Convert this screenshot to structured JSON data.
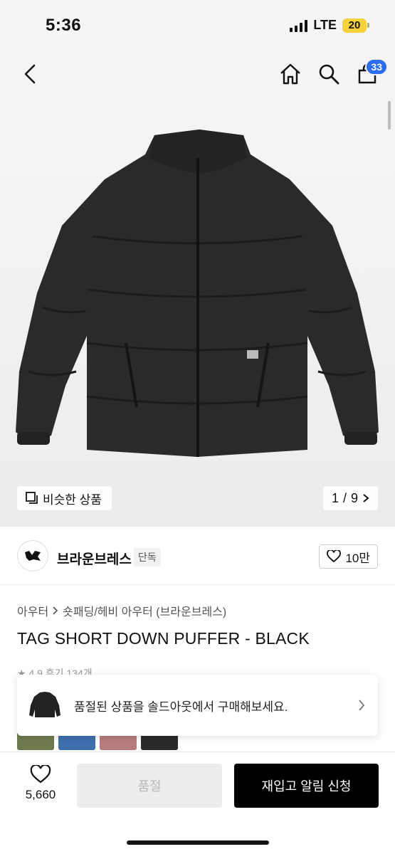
{
  "status": {
    "time": "5:36",
    "network": "LTE",
    "battery": "20"
  },
  "header": {
    "cart_count": "33"
  },
  "gallery": {
    "similar_label": "비슷한 상품",
    "page_current": "1",
    "page_separator": "/",
    "page_total": "9"
  },
  "brand": {
    "name": "브라운브레스",
    "tag": "단독",
    "likes": "10만"
  },
  "product": {
    "category_1": "아우터",
    "category_2": "숏패딩/헤비 아우터 (브라운브레스)",
    "title": "TAG SHORT DOWN PUFFER - BLACK",
    "rating_peek": "★ 4.9  후기 134개"
  },
  "banner": {
    "text": "품절된 상품을 솔드아웃에서 구매해보세요."
  },
  "swatches": [
    "#6e7a4e",
    "#3e6fae",
    "#b77b7b",
    "#2a2a2a"
  ],
  "bottom": {
    "wish_count": "5,660",
    "soldout_label": "품절",
    "restock_label": "재입고 알림 신청"
  },
  "colors": {
    "accent": "#2d6cf6",
    "battery": "#f3d23a"
  }
}
